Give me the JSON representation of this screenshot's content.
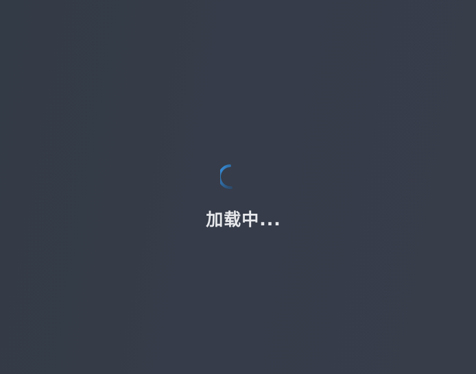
{
  "loading": {
    "text": "加载中...",
    "spinner_icon": "spinner-icon",
    "accent_color": "#2f8fe8"
  }
}
